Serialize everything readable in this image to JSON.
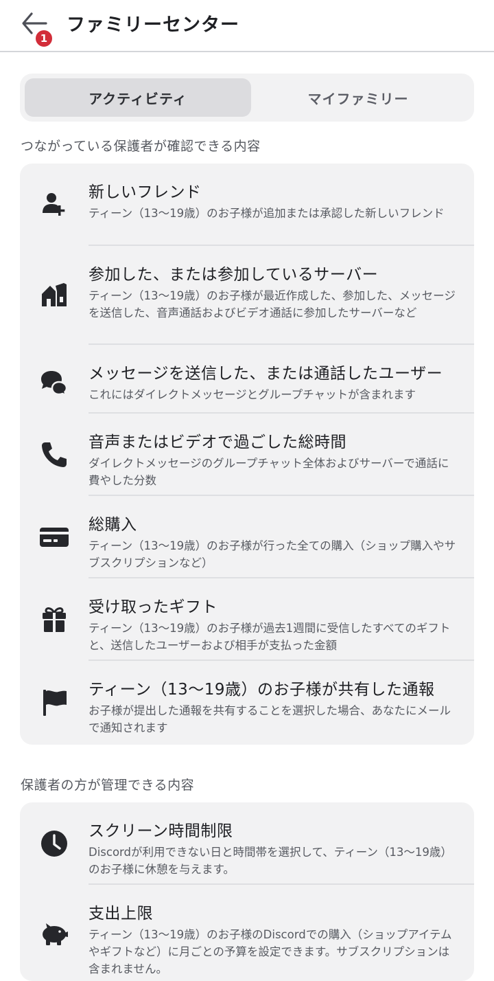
{
  "header": {
    "title": "ファミリーセンター",
    "back_icon": "arrow-left-icon",
    "notification_count": "1",
    "badge_color": "#d22d39"
  },
  "tabs": [
    {
      "label": "アクティビティ",
      "active": true
    },
    {
      "label": "マイファミリー",
      "active": false
    }
  ],
  "sections": [
    {
      "heading": "つながっている保護者が確認できる内容",
      "items": [
        {
          "icon": "user-plus-icon",
          "title": "新しいフレンド",
          "description": "ティーン（13〜19歳）のお子様が追加または承認した新しいフレンド"
        },
        {
          "icon": "server-icon",
          "title": "参加した、または参加しているサーバー",
          "description": "ティーン（13〜19歳）のお子様が最近作成した、参加した、メッセージを送信した、音声通話およびビデオ通話に参加したサーバーなど"
        },
        {
          "icon": "chat-bubbles-icon",
          "title": "メッセージを送信した、または通話したユーザー",
          "description": "これにはダイレクトメッセージとグループチャットが含まれます"
        },
        {
          "icon": "phone-icon",
          "title": "音声またはビデオで過ごした総時間",
          "description": "ダイレクトメッセージのグループチャット全体およびサーバーで通話に費やした分数"
        },
        {
          "icon": "credit-card-icon",
          "title": "総購入",
          "description": "ティーン（13〜19歳）のお子様が行った全ての購入（ショップ購入やサブスクリプションなど）"
        },
        {
          "icon": "gift-icon",
          "title": "受け取ったギフト",
          "description": "ティーン（13〜19歳）のお子様が過去1週間に受信したすべてのギフトと、送信したユーザーおよび相手が支払った金額"
        },
        {
          "icon": "flag-icon",
          "title": "ティーン（13〜19歳）のお子様が共有した通報",
          "description": "お子様が提出した通報を共有することを選択した場合、あなたにメールで通知されます"
        }
      ]
    },
    {
      "heading": "保護者の方が管理できる内容",
      "items": [
        {
          "icon": "clock-icon",
          "title": "スクリーン時間制限",
          "description": "Discordが利用できない日と時間帯を選択して、ティーン（13〜19歳）のお子様に休憩を与えます。"
        },
        {
          "icon": "piggy-bank-icon",
          "title": "支出上限",
          "description": "ティーン（13〜19歳）のお子様のDiscordでの購入（ショップアイテムやギフトなど）に月ごとの予算を設定できます。サブスクリプションは含まれません。"
        }
      ]
    }
  ]
}
